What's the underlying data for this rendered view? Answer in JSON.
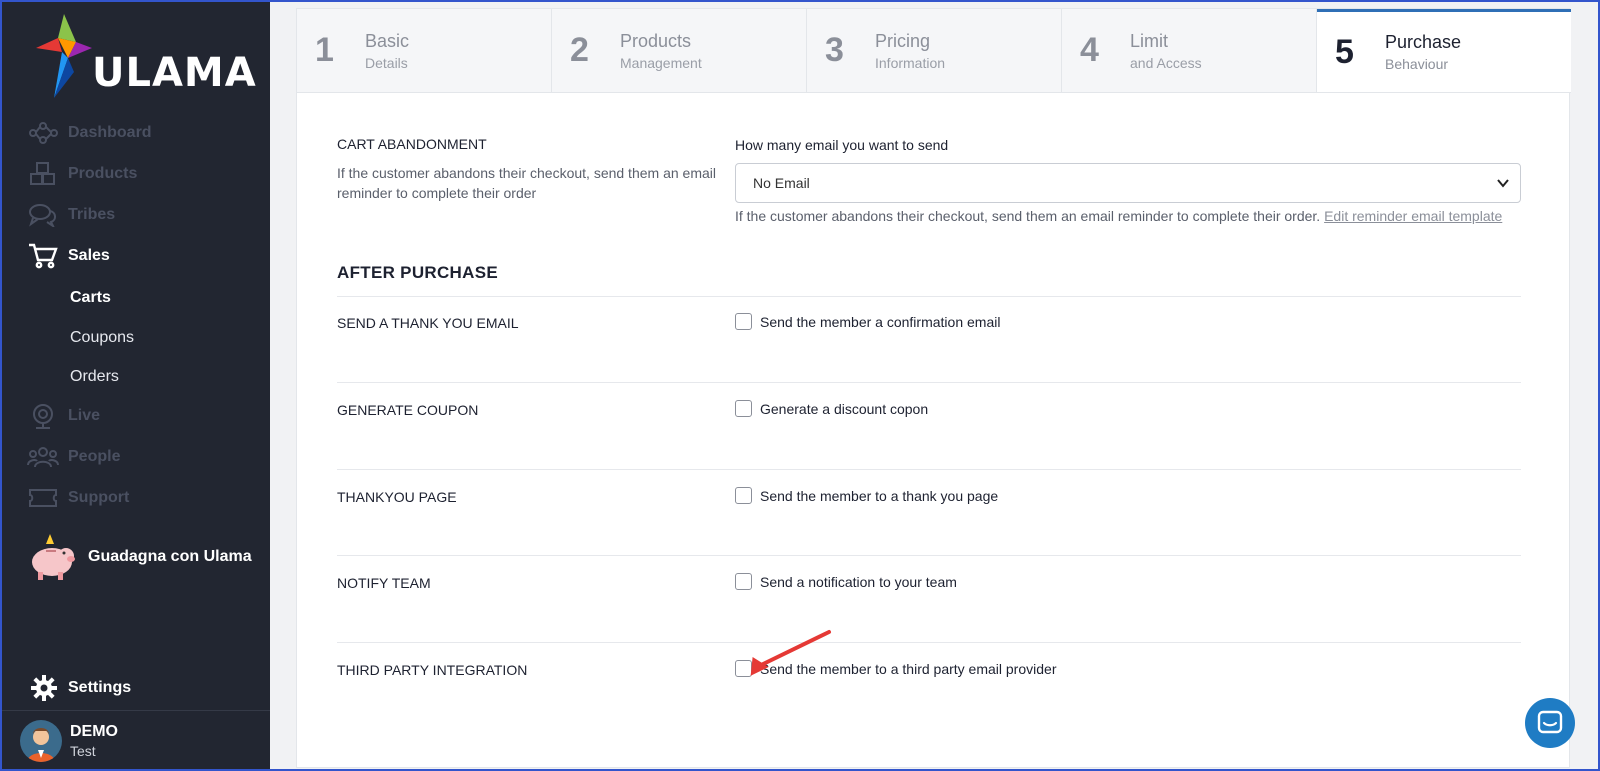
{
  "app": {
    "logo_text": "ULAMA"
  },
  "sidebar": {
    "items": [
      {
        "label": "Dashboard",
        "icon": "dashboard-network-icon",
        "active": false
      },
      {
        "label": "Products",
        "icon": "cubes-icon",
        "active": false
      },
      {
        "label": "Tribes",
        "icon": "chat-bubbles-icon",
        "active": false
      },
      {
        "label": "Sales",
        "icon": "cart-icon",
        "active": true
      },
      {
        "label": "Live",
        "icon": "webcam-icon",
        "active": false
      },
      {
        "label": "People",
        "icon": "people-icon",
        "active": false
      },
      {
        "label": "Support",
        "icon": "ticket-icon",
        "active": false
      }
    ],
    "sales_sub": [
      {
        "label": "Carts",
        "active": true
      },
      {
        "label": "Coupons",
        "active": false
      },
      {
        "label": "Orders",
        "active": false
      }
    ],
    "promo_label": "Guadagna con Ulama",
    "settings_label": "Settings",
    "user": {
      "name": "DEMO",
      "sub": "Test"
    }
  },
  "steps": [
    {
      "num": "1",
      "title": "Basic",
      "subtitle": "Details",
      "active": false
    },
    {
      "num": "2",
      "title": "Products",
      "subtitle": "Management",
      "active": false
    },
    {
      "num": "3",
      "title": "Pricing",
      "subtitle": "Information",
      "active": false
    },
    {
      "num": "4",
      "title": "Limit",
      "subtitle": "and Access",
      "active": false
    },
    {
      "num": "5",
      "title": "Purchase",
      "subtitle": "Behaviour",
      "active": true
    }
  ],
  "cart_abandonment": {
    "title": "CART ABANDONMENT",
    "description": "If the customer abandons their checkout, send them an email reminder to complete their order",
    "select_label": "How many email you want to send",
    "select_value": "No Email",
    "help_text": "If the customer abandons their checkout, send them an email reminder to complete their order.",
    "help_link": "Edit reminder email template"
  },
  "after_purchase": {
    "title": "AFTER PURCHASE",
    "rows": [
      {
        "label": "SEND A THANK YOU EMAIL",
        "checkbox_label": "Send the member a confirmation email",
        "checked": false
      },
      {
        "label": "GENERATE COUPON",
        "checkbox_label": "Generate a discount copon",
        "checked": false
      },
      {
        "label": "THANKYOU PAGE",
        "checkbox_label": "Send the member to a thank you page",
        "checked": false
      },
      {
        "label": "NOTIFY TEAM",
        "checkbox_label": "Send a notification to your team",
        "checked": false
      },
      {
        "label": "THIRD PARTY INTEGRATION",
        "checkbox_label": "Send the member to a third party email provider",
        "checked": false
      }
    ]
  },
  "colors": {
    "sidebar_bg": "#222631",
    "accent": "#2f6fb6",
    "arrow": "#e53935",
    "chat": "#1f7cc4"
  }
}
